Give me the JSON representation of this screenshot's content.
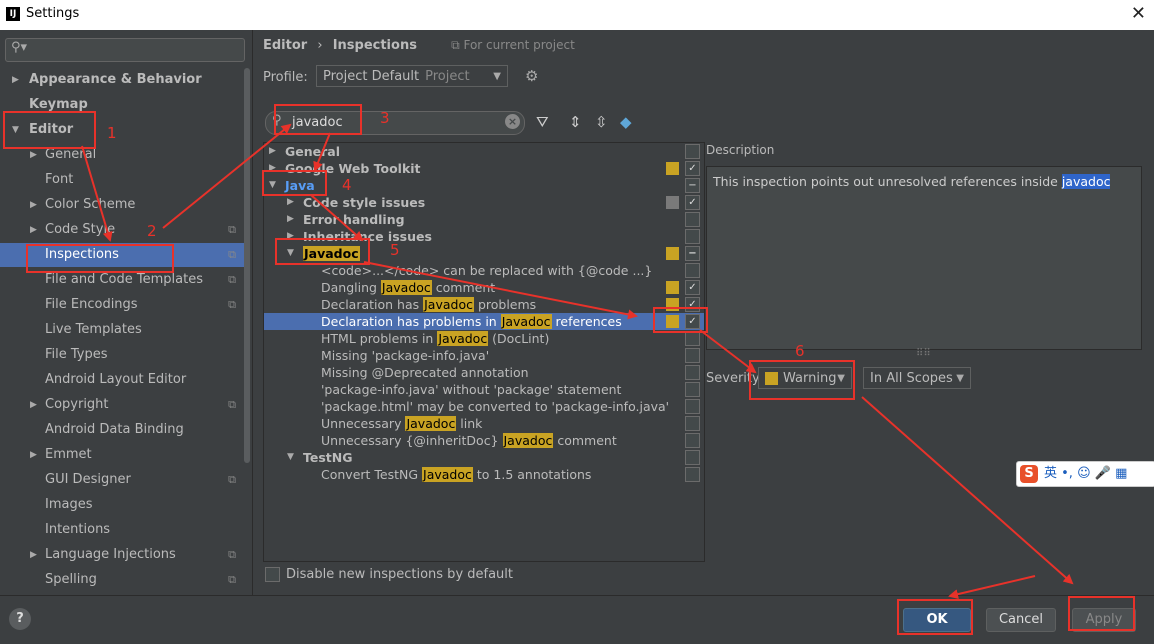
{
  "window": {
    "title": "Settings",
    "close": "✕",
    "app_icon": "IJ"
  },
  "sidebar": {
    "search_placeholder": "",
    "items": [
      {
        "label": "Appearance & Behavior"
      },
      {
        "label": "Keymap"
      },
      {
        "label": "Editor"
      },
      {
        "label": "General"
      },
      {
        "label": "Font"
      },
      {
        "label": "Color Scheme"
      },
      {
        "label": "Code Style"
      },
      {
        "label": "Inspections"
      },
      {
        "label": "File and Code Templates"
      },
      {
        "label": "File Encodings"
      },
      {
        "label": "Live Templates"
      },
      {
        "label": "File Types"
      },
      {
        "label": "Android Layout Editor"
      },
      {
        "label": "Copyright"
      },
      {
        "label": "Android Data Binding"
      },
      {
        "label": "Emmet"
      },
      {
        "label": "GUI Designer"
      },
      {
        "label": "Images"
      },
      {
        "label": "Intentions"
      },
      {
        "label": "Language Injections"
      },
      {
        "label": "Spelling"
      }
    ]
  },
  "header": {
    "crumb_root": "Editor",
    "crumb_sep": "›",
    "crumb_page": "Inspections",
    "scope_note": "⧉ For current project"
  },
  "profile": {
    "label": "Profile:",
    "value": "Project Default",
    "kind": "Project"
  },
  "filter": {
    "value": "javadoc"
  },
  "tree": {
    "general": "General",
    "gwt": "Google Web Toolkit",
    "java": "Java",
    "code_style": "Code style issues",
    "error_handling": "Error handling",
    "inheritance": "Inheritance issues",
    "javadoc": "Javadoc",
    "r1": "<code>...</code> can be replaced with {@code ...}",
    "r2_pre": "Dangling ",
    "r2_post": " comment",
    "r3_pre": "Declaration has ",
    "r3_post": " problems",
    "r4_pre": "Declaration has problems in ",
    "r4_post": " references",
    "r5_pre": "HTML problems in ",
    "r5_post": " (DocLint)",
    "r6": "Missing 'package-info.java'",
    "r7": "Missing @Deprecated annotation",
    "r8": "'package-info.java' without 'package' statement",
    "r9": "'package.html' may be converted to 'package-info.java'",
    "r10_pre": "Unnecessary ",
    "r10_post": " link",
    "r11_pre": "Unnecessary {@inheritDoc} ",
    "r11_post": " comment",
    "testng": "TestNG",
    "r12_pre": "Convert TestNG ",
    "r12_post": " to 1.5 annotations",
    "hl": "Javadoc"
  },
  "description": {
    "label": "Description",
    "text": "This inspection points out unresolved references inside ",
    "highlight": "javadoc"
  },
  "severity": {
    "label": "Severity:",
    "value": "Warning",
    "scope": "In All Scopes"
  },
  "options": {
    "disable_new": "Disable new inspections by default"
  },
  "ime": {
    "text": "英 •, ☺ 🎤 ▦"
  },
  "buttons": {
    "ok": "OK",
    "cancel": "Cancel",
    "apply": "Apply",
    "help": "?"
  },
  "annotations": [
    "1",
    "2",
    "3",
    "4",
    "5",
    "6"
  ],
  "colors": {
    "annotation": "#e8322a",
    "selection": "#4b6eaf",
    "warning": "#c9a323",
    "highlight": "#c9a323"
  }
}
